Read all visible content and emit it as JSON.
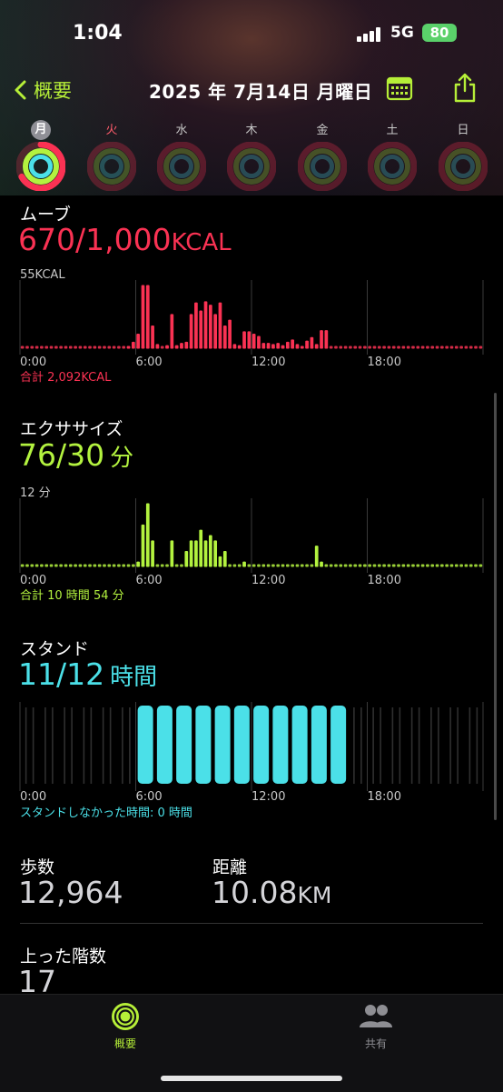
{
  "status": {
    "time": "1:04",
    "network": "5G",
    "battery": "80"
  },
  "nav": {
    "back_label": "概要",
    "title": "2025 年 7月14日 月曜日"
  },
  "week": [
    {
      "label": "月",
      "today": true
    },
    {
      "label": "火",
      "today": false
    },
    {
      "label": "水",
      "today": false
    },
    {
      "label": "木",
      "today": false
    },
    {
      "label": "金",
      "today": false
    },
    {
      "label": "土",
      "today": false
    },
    {
      "label": "日",
      "today": false
    }
  ],
  "colors": {
    "move": "#fa3253",
    "exercise": "#b3f23f",
    "stand": "#4be0e8",
    "accent": "#b6ef38"
  },
  "move": {
    "label": "ムーブ",
    "value": "670/1,000",
    "unit": "KCAL",
    "total": "合計 2,092KCAL"
  },
  "exercise": {
    "label": "エクササイズ",
    "value": "76/30",
    "unit": "分",
    "total": "合計 10 時間 54 分"
  },
  "stand": {
    "label": "スタンド",
    "value": "11/12",
    "unit": "時間",
    "total": "スタンドしなかった時間: 0 時間"
  },
  "stats": {
    "steps_label": "歩数",
    "steps_value": "12,964",
    "distance_label": "距離",
    "distance_value": "10.08",
    "distance_unit": "KM",
    "floors_label": "上った階数",
    "floors_value": "17"
  },
  "chart_data": [
    {
      "type": "bar",
      "title": "ムーブ",
      "ymax_label": "55KCAL",
      "ylim": [
        0,
        55
      ],
      "xticks": [
        "0:00",
        "6:00",
        "12:00",
        "18:00"
      ],
      "x_unit": "minute-slot (15 min)",
      "bars": [
        {
          "slot": 22,
          "v": 2
        },
        {
          "slot": 23,
          "v": 6
        },
        {
          "slot": 24,
          "v": 13
        },
        {
          "slot": 25,
          "v": 55
        },
        {
          "slot": 26,
          "v": 55
        },
        {
          "slot": 27,
          "v": 20
        },
        {
          "slot": 28,
          "v": 4
        },
        {
          "slot": 30,
          "v": 3
        },
        {
          "slot": 31,
          "v": 30
        },
        {
          "slot": 32,
          "v": 3
        },
        {
          "slot": 33,
          "v": 5
        },
        {
          "slot": 34,
          "v": 6
        },
        {
          "slot": 35,
          "v": 30
        },
        {
          "slot": 36,
          "v": 40
        },
        {
          "slot": 37,
          "v": 33
        },
        {
          "slot": 38,
          "v": 41
        },
        {
          "slot": 39,
          "v": 38
        },
        {
          "slot": 40,
          "v": 30
        },
        {
          "slot": 41,
          "v": 40
        },
        {
          "slot": 42,
          "v": 20
        },
        {
          "slot": 43,
          "v": 25
        },
        {
          "slot": 44,
          "v": 4
        },
        {
          "slot": 45,
          "v": 3
        },
        {
          "slot": 46,
          "v": 15
        },
        {
          "slot": 47,
          "v": 15
        },
        {
          "slot": 48,
          "v": 13
        },
        {
          "slot": 49,
          "v": 11
        },
        {
          "slot": 50,
          "v": 5
        },
        {
          "slot": 51,
          "v": 5
        },
        {
          "slot": 52,
          "v": 4
        },
        {
          "slot": 53,
          "v": 5
        },
        {
          "slot": 54,
          "v": 3
        },
        {
          "slot": 55,
          "v": 6
        },
        {
          "slot": 56,
          "v": 8
        },
        {
          "slot": 57,
          "v": 4
        },
        {
          "slot": 58,
          "v": 2
        },
        {
          "slot": 59,
          "v": 7
        },
        {
          "slot": 60,
          "v": 10
        },
        {
          "slot": 61,
          "v": 4
        },
        {
          "slot": 62,
          "v": 16
        },
        {
          "slot": 63,
          "v": 16
        }
      ]
    },
    {
      "type": "bar",
      "title": "エクササイズ",
      "ymax_label": "12 分",
      "ylim": [
        0,
        12
      ],
      "xticks": [
        "0:00",
        "6:00",
        "12:00",
        "18:00"
      ],
      "bars": [
        {
          "slot": 24,
          "v": 1
        },
        {
          "slot": 25,
          "v": 8
        },
        {
          "slot": 26,
          "v": 12
        },
        {
          "slot": 27,
          "v": 5
        },
        {
          "slot": 31,
          "v": 5
        },
        {
          "slot": 34,
          "v": 3
        },
        {
          "slot": 35,
          "v": 5
        },
        {
          "slot": 36,
          "v": 5
        },
        {
          "slot": 37,
          "v": 7
        },
        {
          "slot": 38,
          "v": 5
        },
        {
          "slot": 39,
          "v": 6
        },
        {
          "slot": 40,
          "v": 5
        },
        {
          "slot": 41,
          "v": 2
        },
        {
          "slot": 42,
          "v": 3
        },
        {
          "slot": 46,
          "v": 1
        },
        {
          "slot": 61,
          "v": 4
        },
        {
          "slot": 62,
          "v": 1
        }
      ]
    },
    {
      "type": "bar",
      "title": "スタンド",
      "xticks": [
        "0:00",
        "6:00",
        "12:00",
        "18:00"
      ],
      "stood_hours": [
        6,
        7,
        8,
        9,
        10,
        11,
        12,
        13,
        14,
        15,
        16
      ]
    }
  ],
  "tabs": [
    {
      "label": "概要",
      "active": true
    },
    {
      "label": "共有",
      "active": false
    }
  ]
}
